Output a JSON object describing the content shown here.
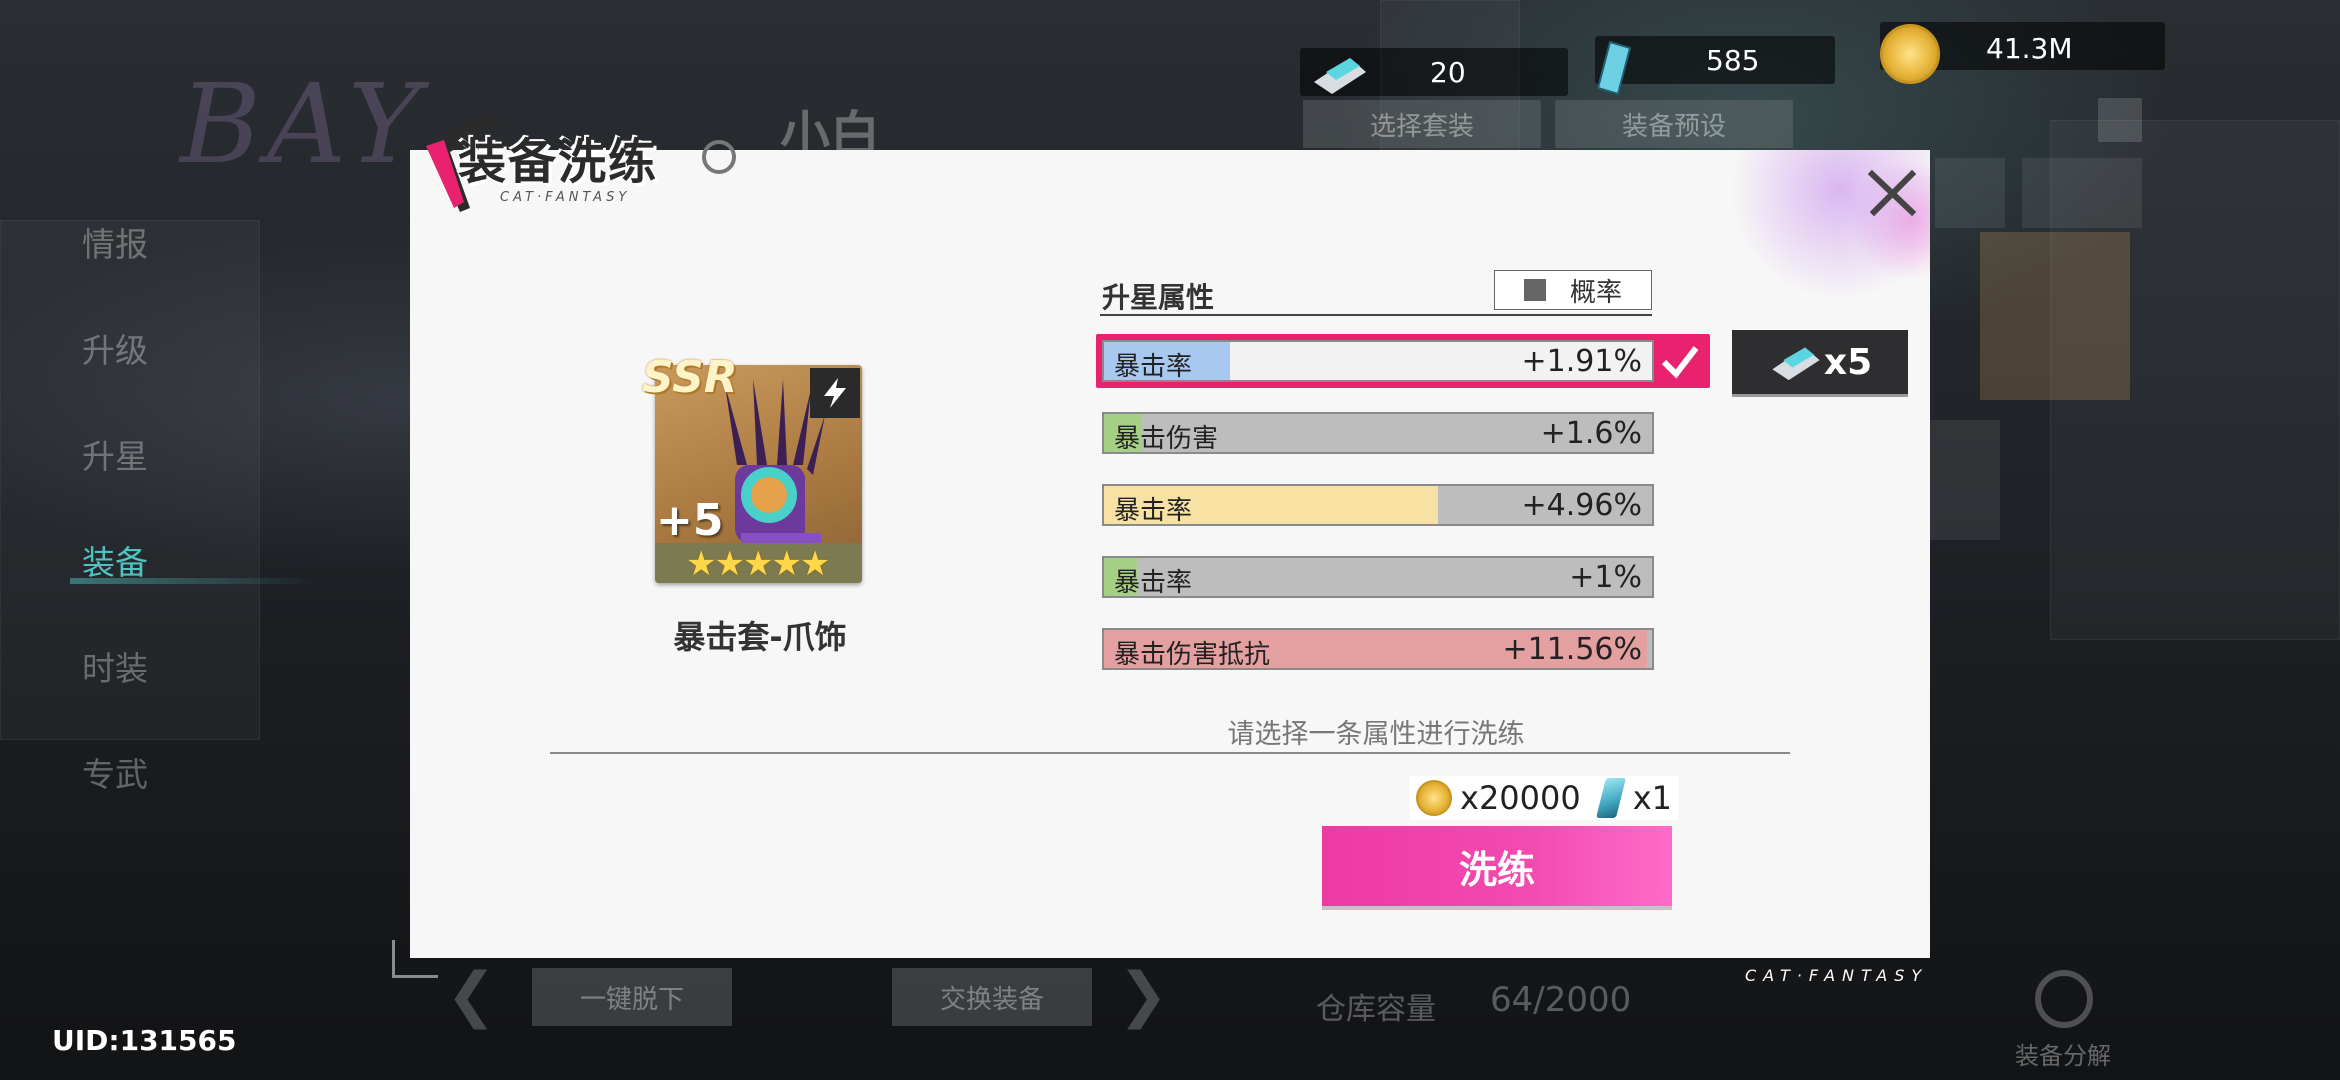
{
  "resources": [
    {
      "icon": "ticket-icon",
      "value": "20"
    },
    {
      "icon": "crystal-icon",
      "value": "585"
    },
    {
      "icon": "coin-icon",
      "value": "41.3M"
    }
  ],
  "top_buttons": {
    "select_set": "选择套装",
    "preset": "装备预设"
  },
  "side_nav": [
    "情报",
    "升级",
    "升星",
    "装备",
    "时装",
    "专武"
  ],
  "side_nav_active": "装备",
  "background_name": "小白",
  "bottom": {
    "unequip_all": "一键脱下",
    "swap": "交换装备",
    "storage_label": "仓库容量",
    "storage_value": "64/2000",
    "decompose": "装备分解",
    "uid": "UID:131565",
    "brand": "CAT·FANTASY"
  },
  "dialog": {
    "title": "装备洗练",
    "title_sub": "CAT·FANTASY",
    "item": {
      "rarity": "SSR",
      "level": "+5",
      "stars": "★★★★★",
      "name": "暴击套-爪饰"
    },
    "attr_header": "升星属性",
    "prob_label": "概率",
    "attributes": [
      {
        "name": "暴击率",
        "value": "+1.91%",
        "fill": 0.23,
        "color": "#a9c8ef",
        "selected": true
      },
      {
        "name": "暴击伤害",
        "value": "+1.6%",
        "fill": 0.07,
        "color": "#a6cf86",
        "selected": false
      },
      {
        "name": "暴击率",
        "value": "+4.96%",
        "fill": 0.61,
        "color": "#f7e2a4",
        "selected": false
      },
      {
        "name": "暴击率",
        "value": "+1%",
        "fill": 0.06,
        "color": "#a6cf86",
        "selected": false
      },
      {
        "name": "暴击伤害抵抗",
        "value": "+11.56%",
        "fill": 0.99,
        "color": "#e4a0a0",
        "selected": false
      }
    ],
    "lock_cost": "x5",
    "hint": "请选择一条属性进行洗练",
    "cost_coin": "x20000",
    "cost_crystal": "x1",
    "refine_button": "洗练"
  }
}
